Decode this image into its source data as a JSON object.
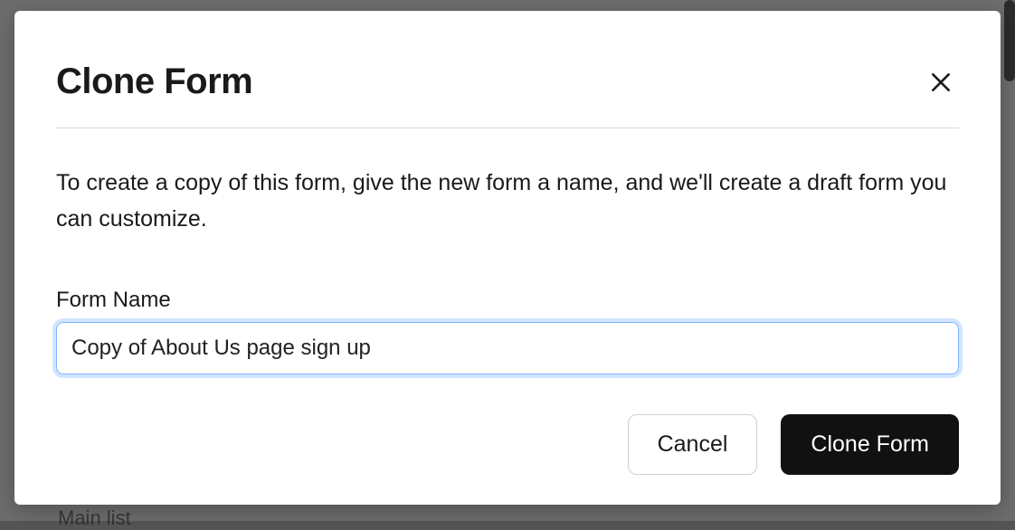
{
  "backgroundHint": "Main list",
  "modal": {
    "title": "Clone Form",
    "description": "To create a copy of this form, give the new form a name, and we'll create a draft form you can customize.",
    "field": {
      "label": "Form Name",
      "value": "Copy of About Us page sign up"
    },
    "actions": {
      "cancel": "Cancel",
      "confirm": "Clone Form"
    }
  }
}
